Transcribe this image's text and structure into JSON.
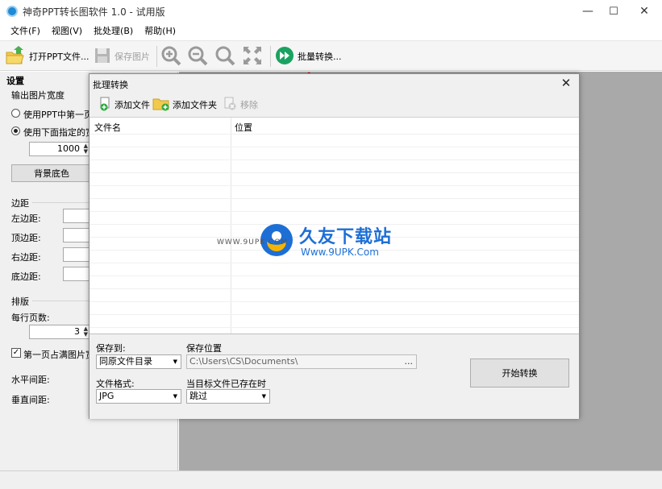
{
  "window": {
    "title": "神奇PPT转长图软件 1.0 - 试用版",
    "minimize": "—",
    "maximize": "☐",
    "close": "✕"
  },
  "menu": [
    "文件(F)",
    "视图(V)",
    "批处理(B)",
    "帮助(H)"
  ],
  "toolbar": {
    "open": "打开PPT文件...",
    "save": "保存图片",
    "batch": "批量转换..."
  },
  "settings": {
    "title": "设置",
    "output_width": "输出图片宽度",
    "radio1": "使用PPT中第一页",
    "radio2": "使用下面指定的宽",
    "width_value": "1000",
    "bg_button": "背景底色",
    "margin_group": "边距",
    "left_margin": "左边距:",
    "top_margin": "顶边距:",
    "right_margin": "右边距:",
    "bottom_margin": "底边距:",
    "layout_group": "排版",
    "per_row": "每行页数:",
    "per_row_value": "3",
    "first_page_full": "第一页占满图片宽",
    "h_spacing": "水平间距:",
    "v_spacing": "垂直间距:"
  },
  "dialog": {
    "title": "批理转换",
    "close": "✕",
    "add_file": "添加文件",
    "add_folder": "添加文件夹",
    "remove": "移除",
    "col_filename": "文件名",
    "col_location": "位置",
    "save_to_label": "保存到:",
    "save_to_value": "同原文件目录",
    "save_location_label": "保存位置",
    "save_location_value": "C:\\Users\\CS\\Documents\\",
    "browse": "...",
    "format_label": "文件格式:",
    "format_value": "JPG",
    "exists_label": "当目标文件已存在时",
    "exists_value": "跳过",
    "start_button": "开始转换"
  },
  "watermark": {
    "brand": "久友下载站",
    "url": "Www.9UPK.Com",
    "prefix": "WWW.9UPK.COM"
  },
  "colors": {
    "accent_blue": "#1d8ad6",
    "workspace_gray": "#a9a9a9",
    "arrow_red": "#d9251d"
  }
}
